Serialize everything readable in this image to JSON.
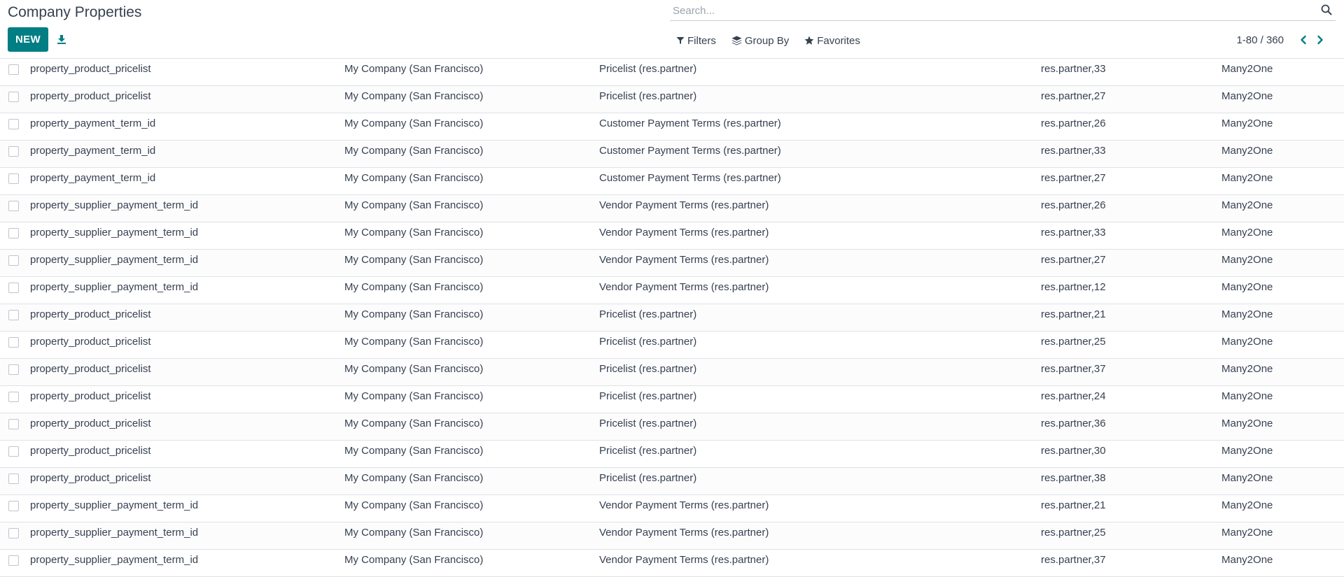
{
  "header": {
    "title": "Company Properties",
    "new_label": "NEW"
  },
  "search": {
    "placeholder": "Search..."
  },
  "search_options": {
    "filters_label": "Filters",
    "group_by_label": "Group By",
    "favorites_label": "Favorites"
  },
  "pager": {
    "value": "1-80 / 360"
  },
  "icons": {
    "download": "download-icon",
    "search": "search-icon",
    "filter": "filter-icon",
    "layers": "layers-icon",
    "star": "star-icon",
    "prev": "chevron-left-icon",
    "next": "chevron-right-icon"
  },
  "colors": {
    "primary": "#017e84",
    "text": "#374151",
    "border": "#dee2e6"
  },
  "rows": [
    {
      "name": "property_product_pricelist",
      "company": "My Company (San Francisco)",
      "field": "Pricelist (res.partner)",
      "resource": "res.partner,33",
      "type": "Many2One"
    },
    {
      "name": "property_product_pricelist",
      "company": "My Company (San Francisco)",
      "field": "Pricelist (res.partner)",
      "resource": "res.partner,27",
      "type": "Many2One"
    },
    {
      "name": "property_payment_term_id",
      "company": "My Company (San Francisco)",
      "field": "Customer Payment Terms (res.partner)",
      "resource": "res.partner,26",
      "type": "Many2One"
    },
    {
      "name": "property_payment_term_id",
      "company": "My Company (San Francisco)",
      "field": "Customer Payment Terms (res.partner)",
      "resource": "res.partner,33",
      "type": "Many2One"
    },
    {
      "name": "property_payment_term_id",
      "company": "My Company (San Francisco)",
      "field": "Customer Payment Terms (res.partner)",
      "resource": "res.partner,27",
      "type": "Many2One"
    },
    {
      "name": "property_supplier_payment_term_id",
      "company": "My Company (San Francisco)",
      "field": "Vendor Payment Terms (res.partner)",
      "resource": "res.partner,26",
      "type": "Many2One"
    },
    {
      "name": "property_supplier_payment_term_id",
      "company": "My Company (San Francisco)",
      "field": "Vendor Payment Terms (res.partner)",
      "resource": "res.partner,33",
      "type": "Many2One"
    },
    {
      "name": "property_supplier_payment_term_id",
      "company": "My Company (San Francisco)",
      "field": "Vendor Payment Terms (res.partner)",
      "resource": "res.partner,27",
      "type": "Many2One"
    },
    {
      "name": "property_supplier_payment_term_id",
      "company": "My Company (San Francisco)",
      "field": "Vendor Payment Terms (res.partner)",
      "resource": "res.partner,12",
      "type": "Many2One"
    },
    {
      "name": "property_product_pricelist",
      "company": "My Company (San Francisco)",
      "field": "Pricelist (res.partner)",
      "resource": "res.partner,21",
      "type": "Many2One"
    },
    {
      "name": "property_product_pricelist",
      "company": "My Company (San Francisco)",
      "field": "Pricelist (res.partner)",
      "resource": "res.partner,25",
      "type": "Many2One"
    },
    {
      "name": "property_product_pricelist",
      "company": "My Company (San Francisco)",
      "field": "Pricelist (res.partner)",
      "resource": "res.partner,37",
      "type": "Many2One"
    },
    {
      "name": "property_product_pricelist",
      "company": "My Company (San Francisco)",
      "field": "Pricelist (res.partner)",
      "resource": "res.partner,24",
      "type": "Many2One"
    },
    {
      "name": "property_product_pricelist",
      "company": "My Company (San Francisco)",
      "field": "Pricelist (res.partner)",
      "resource": "res.partner,36",
      "type": "Many2One"
    },
    {
      "name": "property_product_pricelist",
      "company": "My Company (San Francisco)",
      "field": "Pricelist (res.partner)",
      "resource": "res.partner,30",
      "type": "Many2One"
    },
    {
      "name": "property_product_pricelist",
      "company": "My Company (San Francisco)",
      "field": "Pricelist (res.partner)",
      "resource": "res.partner,38",
      "type": "Many2One"
    },
    {
      "name": "property_supplier_payment_term_id",
      "company": "My Company (San Francisco)",
      "field": "Vendor Payment Terms (res.partner)",
      "resource": "res.partner,21",
      "type": "Many2One"
    },
    {
      "name": "property_supplier_payment_term_id",
      "company": "My Company (San Francisco)",
      "field": "Vendor Payment Terms (res.partner)",
      "resource": "res.partner,25",
      "type": "Many2One"
    },
    {
      "name": "property_supplier_payment_term_id",
      "company": "My Company (San Francisco)",
      "field": "Vendor Payment Terms (res.partner)",
      "resource": "res.partner,37",
      "type": "Many2One"
    }
  ]
}
